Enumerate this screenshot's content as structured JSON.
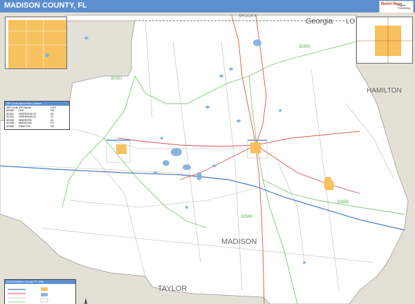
{
  "title": "MADISON COUNTY, FL",
  "logo": {
    "line1": "Market Maps",
    "line2": "Digital Publishing"
  },
  "labels": {
    "georgia": "Georgia",
    "brooks": "BROOKS",
    "lowndes": "LO",
    "hamilton": "HAMILTON",
    "madison": "MADISON",
    "taylor": "TAYLOR"
  },
  "zip_labels": {
    "z32350": "32350",
    "z32331": "32331",
    "z32059": "32059",
    "z32340": "32340"
  },
  "zip_table": {
    "heading": "ZIP Code Index/Grid Locator",
    "columns": [
      "ZIP Code",
      "ZIP Name",
      "LOC"
    ],
    "rows": [
      [
        "32059",
        "LEE",
        "G4"
      ],
      [
        "32331",
        "GREENVILLE",
        "A1"
      ],
      [
        "32331",
        "GREENVILLE",
        "J1"
      ],
      [
        "32340",
        "MADISON",
        "A1"
      ],
      [
        "32340",
        "MADISON",
        "F4"
      ],
      [
        "32350",
        "PINETTA",
        "H2"
      ]
    ]
  },
  "legend": {
    "heading": "2016 Madison County, FL Map"
  },
  "colors": {
    "title_bar": "#5b8fd0",
    "county": "#ffffff",
    "surrounding": "#e3e0d6",
    "water": "#8ab4de",
    "city": "#f7c15d",
    "zip_boundary": "#7bc96f",
    "major_road": "#d9534f",
    "interstate": "#4a7fc9"
  },
  "icons": {
    "compass": "compass-rose-icon"
  }
}
